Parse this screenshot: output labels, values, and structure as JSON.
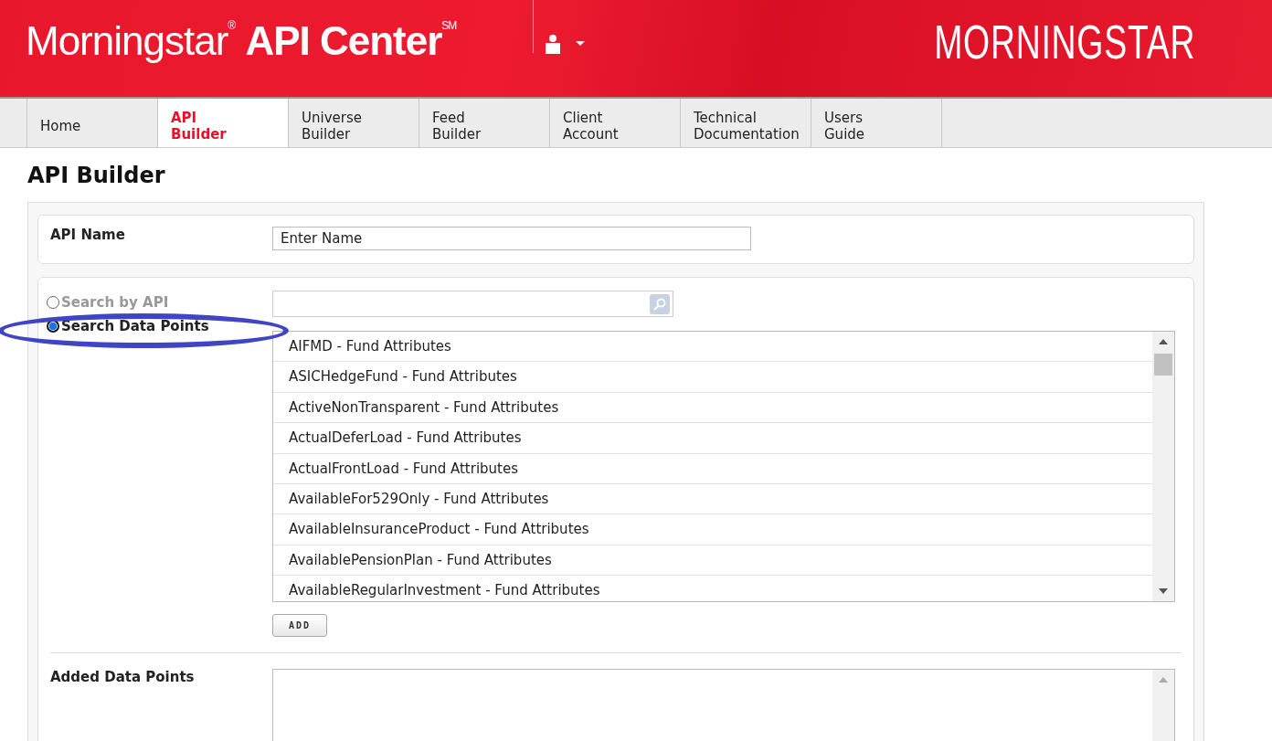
{
  "header": {
    "brand_title": "Morningstar$^{®}$ **API Center**$^{SM}$",
    "logo": "MORNINGSTAR"
  },
  "tabs": [
    {
      "label": "Home",
      "selected": false
    },
    {
      "label": "API Builder",
      "selected": true
    },
    {
      "label": "Universe Builder",
      "selected": false
    },
    {
      "label": "Feed Builder",
      "selected": false
    },
    {
      "label": "Client Account",
      "selected": false
    },
    {
      "label": "Technical Documentation",
      "selected": false
    },
    {
      "label": "Users Guide",
      "selected": false
    }
  ],
  "page_title": "API Builder",
  "api_name": {
    "label": "API Name",
    "value": "Enter Name"
  },
  "search_modes": [
    {
      "label": "Search by API",
      "selected": false
    },
    {
      "label": "Search Data Points",
      "selected": true
    }
  ],
  "data_points": [
    "AIFMD - Fund Attributes",
    "ASICHedgeFund - Fund Attributes",
    "ActiveNonTransparent - Fund Attributes",
    "ActualDeferLoad - Fund Attributes",
    "ActualFrontLoad - Fund Attributes",
    "AvailableFor529Only - Fund Attributes",
    "AvailableInsuranceProduct - Fund Attributes",
    "AvailablePensionPlan - Fund Attributes",
    "AvailableRegularInvestment - Fund Attributes"
  ],
  "add_button": "ADD",
  "added_label": "Added Data Points"
}
